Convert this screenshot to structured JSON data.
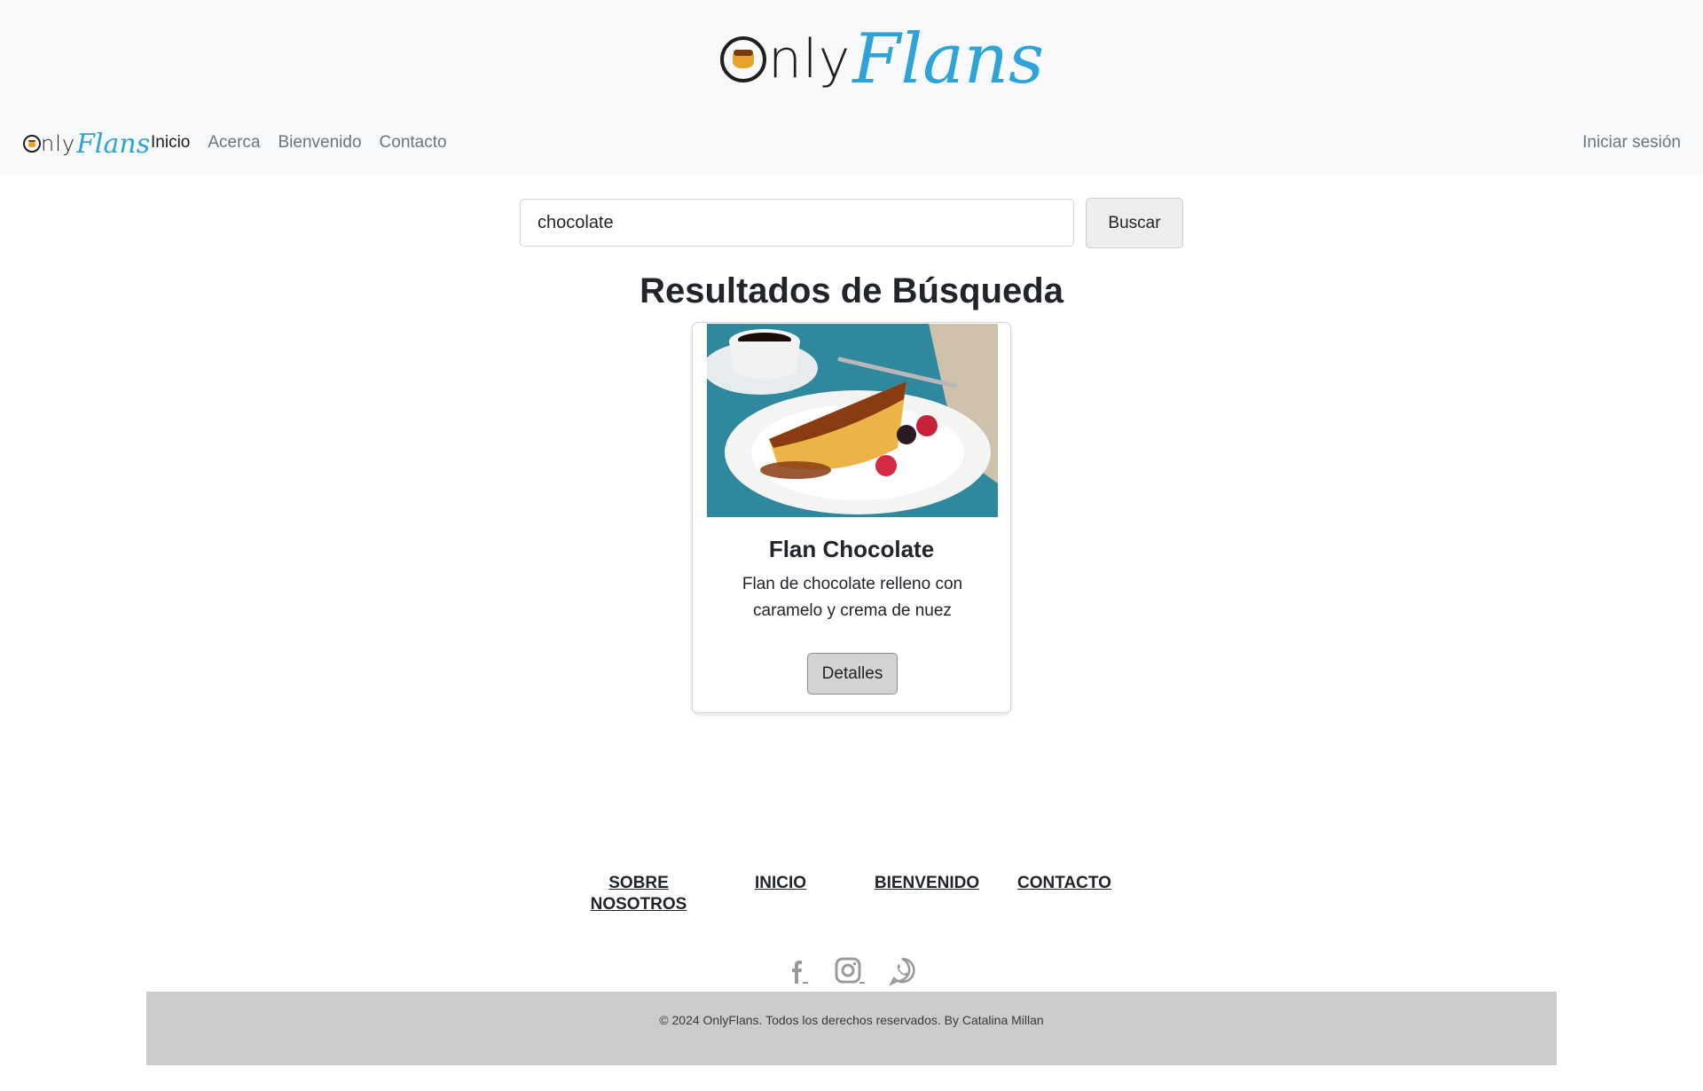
{
  "brand": {
    "logo_text_plain": "Only",
    "logo_text_script": "Flans",
    "colors": {
      "script": "#2ea3d8",
      "plain": "#1f1f1f",
      "header_bg": "#f8f9fa"
    }
  },
  "nav": {
    "items": [
      {
        "label": "Inicio",
        "active": true
      },
      {
        "label": "Acerca",
        "active": false
      },
      {
        "label": "Bienvenido",
        "active": false
      },
      {
        "label": "Contacto",
        "active": false
      }
    ],
    "login_label": "Iniciar sesión"
  },
  "search": {
    "value": "chocolate",
    "placeholder": "",
    "button_label": "Buscar"
  },
  "results": {
    "title": "Resultados de Búsqueda",
    "cards": [
      {
        "title": "Flan Chocolate",
        "description": "Flan de chocolate relleno con caramelo y crema de nuez",
        "image_icon": "flan-photo",
        "button_label": "Detalles"
      }
    ]
  },
  "footer": {
    "links": [
      {
        "label": "SOBRE NOSOTROS"
      },
      {
        "label": "INICIO"
      },
      {
        "label": "BIENVENIDO"
      },
      {
        "label": "CONTACTO"
      }
    ],
    "social": [
      "facebook-icon",
      "instagram-icon",
      "whatsapp-icon"
    ],
    "copyright": "© 2024 OnlyFlans. Todos los derechos reservados. By Catalina Millan",
    "colors": {
      "bar": "#cbcbcb",
      "icons": "#9a9a9a"
    }
  }
}
